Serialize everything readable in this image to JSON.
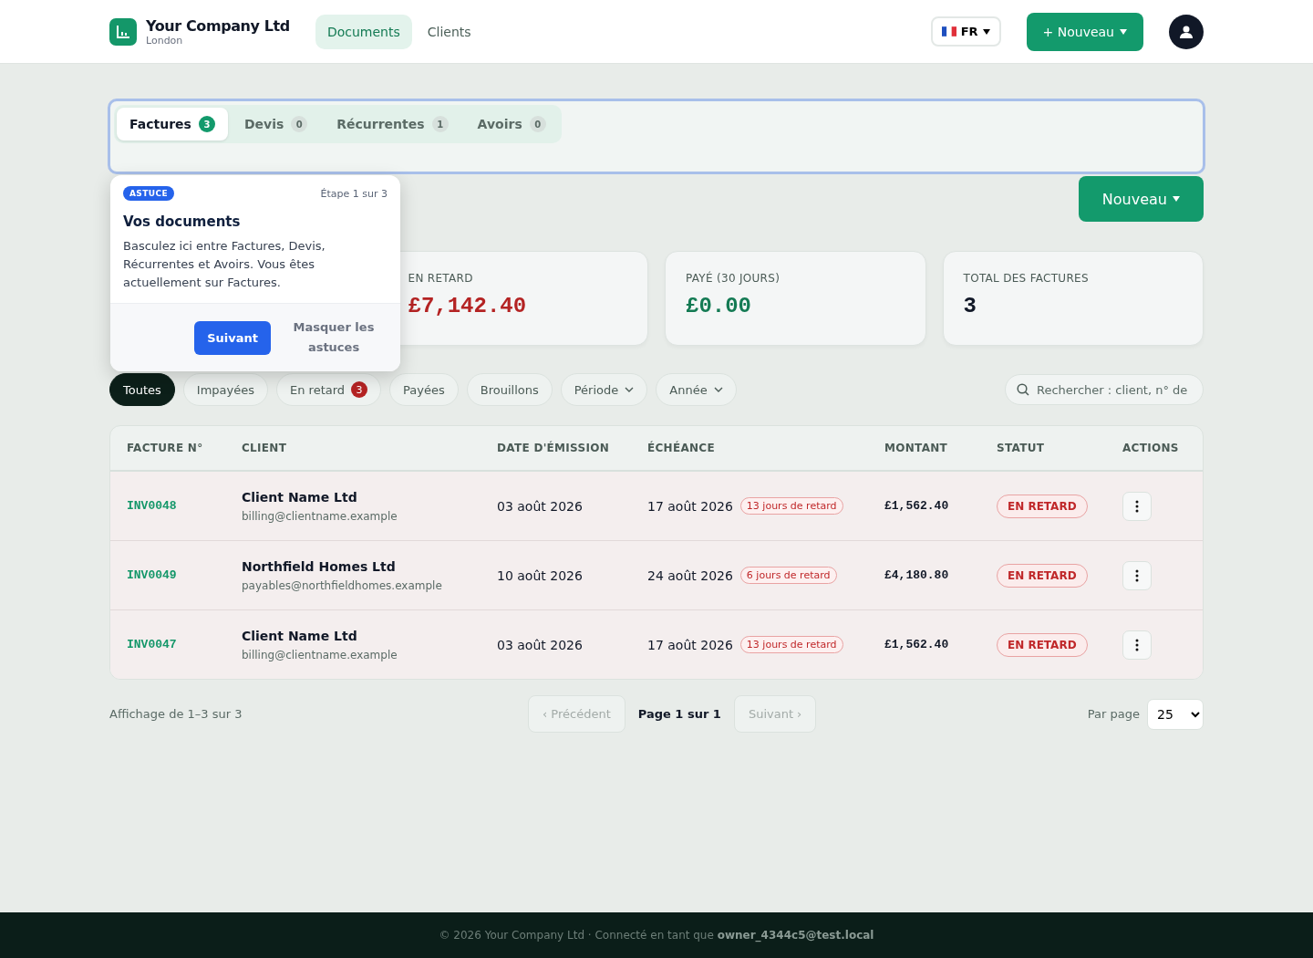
{
  "header": {
    "company": "Your Company Ltd",
    "city": "London",
    "nav": [
      {
        "label": "Documents",
        "selected": true
      },
      {
        "label": "Clients",
        "selected": false
      }
    ],
    "language": "FR",
    "new_button": "+ Nouveau"
  },
  "doc_tabs": [
    {
      "label": "Factures",
      "count": "3",
      "selected": true
    },
    {
      "label": "Devis",
      "count": "0",
      "selected": false
    },
    {
      "label": "Récurrentes",
      "count": "1",
      "selected": false
    },
    {
      "label": "Avoirs",
      "count": "0",
      "selected": false
    }
  ],
  "new_button": "Nouveau",
  "stats": [
    {
      "label": "EN RETARD",
      "value": "£7,142.40",
      "color": "#b42323"
    },
    {
      "label": "PAYÉ (30 JOURS)",
      "value": "£0.00",
      "color": "#137a53"
    },
    {
      "label": "TOTAL DES FACTURES",
      "value": "3",
      "color": "#111827"
    }
  ],
  "filters": [
    {
      "label": "Toutes",
      "selected": true,
      "kind": "chip"
    },
    {
      "label": "Impayées",
      "selected": false,
      "kind": "chip"
    },
    {
      "label": "En retard",
      "selected": false,
      "kind": "chip",
      "count": "3"
    },
    {
      "label": "Payées",
      "selected": false,
      "kind": "chip"
    },
    {
      "label": "Brouillons",
      "selected": false,
      "kind": "chip"
    },
    {
      "label": "Période",
      "selected": false,
      "kind": "dropdown"
    },
    {
      "label": "Année",
      "selected": false,
      "kind": "dropdown"
    }
  ],
  "search": {
    "placeholder": "Rechercher : client, n° de"
  },
  "table": {
    "columns": [
      "FACTURE N°",
      "CLIENT",
      "DATE D'ÉMISSION",
      "ÉCHÉANCE",
      "MONTANT",
      "STATUT",
      "ACTIONS"
    ],
    "rows": [
      {
        "number": "INV0048",
        "client": "Client Name Ltd",
        "email": "billing@clientname.example",
        "issued": "03 août 2026",
        "due": "17 août 2026",
        "late": "13 jours de retard",
        "amount": "£1,562.40",
        "status": "EN RETARD"
      },
      {
        "number": "INV0049",
        "client": "Northfield Homes Ltd",
        "email": "payables@northfieldhomes.example",
        "issued": "10 août 2026",
        "due": "24 août 2026",
        "late": "6 jours de retard",
        "amount": "£4,180.80",
        "status": "EN RETARD"
      },
      {
        "number": "INV0047",
        "client": "Client Name Ltd",
        "email": "billing@clientname.example",
        "issued": "03 août 2026",
        "due": "17 août 2026",
        "late": "13 jours de retard",
        "amount": "£1,562.40",
        "status": "EN RETARD"
      }
    ]
  },
  "pagination": {
    "summary": "Affichage de 1–3 sur 3",
    "previous": "‹ Précédent",
    "page": "Page 1 sur 1",
    "next": "Suivant ›",
    "previous_disabled": true,
    "next_disabled": true,
    "per_page_label": "Par page",
    "per_page": "25"
  },
  "tip": {
    "badge": "ASTUCE",
    "step": "Étape 1 sur 3",
    "title": "Vos documents",
    "body": "Basculez ici entre Factures, Devis, Récurrentes et Avoirs. Vous êtes actuellement sur Factures.",
    "next": "Suivant",
    "hide": "Masquer les astuces"
  },
  "footer": {
    "text": "© 2026 Your Company Ltd · Connecté en tant que ",
    "user": "owner_4344c5@test.local"
  }
}
